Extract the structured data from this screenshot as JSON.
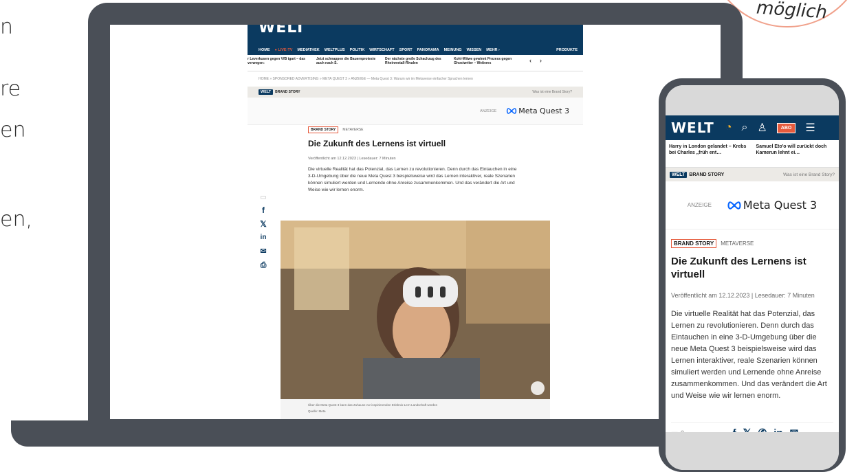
{
  "side_fragments": [
    "n",
    "re",
    "en",
    "en,"
  ],
  "badge": {
    "text": "möglich"
  },
  "desktop": {
    "logo": "WELT",
    "nav": [
      "HOME",
      "LIVE-TV",
      "MEDIATHEK",
      "WELTPLUS",
      "POLITIK",
      "WIRTSCHAFT",
      "SPORT",
      "PANORAMA",
      "MEINUNG",
      "WISSEN",
      "MEHR",
      "PRODUKTE"
    ],
    "ticker": [
      "r Leverkusen gegen VfB tgart – das verwegen:",
      "Jetzt schnappen die Bauernproteste auch nach S.",
      "Der nächste große Schachzug des Rheinmetall-Rivalen",
      "Kohl-Witwe gewinnt Prozess gegen Ghostwriter – Weiteres"
    ],
    "breadcrumb": "HOME » SPONSORED ADVERTISING » META QUEST 3 » ANZEIGE — Meta Quest 3: Warum wir im Metaverse einfacher Sprachen lernen",
    "brand_chip": "WELT",
    "brand_story": "BRAND STORY",
    "what_is": "Was ist eine Brand Story?",
    "anzeige": "ANZEIGE",
    "sponsor": "Meta Quest 3",
    "tag_boxed": "BRAND STORY",
    "tag_plain": "METAVERSE",
    "title": "Die Zukunft des Lernens ist virtuell",
    "meta": "Veröffentlicht am 12.12.2023 | Lesedauer: 7 Minuten",
    "lead": "Die virtuelle Realität hat das Potenzial, das Lernen zu revolutionieren. Denn durch das Eintauchen in eine 3-D-Umgebung über die neue Meta Quest 3 beispielsweise wird das Lernen interaktiver, reale Szenarien können simuliert werden und Lernende ohne Anreise zusammenkommen. Und das verändert die Art und Weise wie wir lernen enorm.",
    "caption": "Über die Meta Quest 3 kann das Zuhause zur inspirierenden Erlebnis-Lern-Landschaft werden",
    "caption_source": "Quelle: Meta"
  },
  "phone": {
    "logo": "WELT",
    "abo": "ABO",
    "ticker": [
      "Harry in London gelandet – Krebs bei Charles „früh ent…",
      "Samuel Eto'o will zurückt doch Kamerun lehnt ei…"
    ],
    "brand_chip": "WELT",
    "brand_story": "BRAND STORY",
    "what_is": "Was ist eine Brand Story?",
    "anzeige": "ANZEIGE",
    "sponsor": "Meta Quest 3",
    "tag_boxed": "BRAND STORY",
    "tag_plain": "METAVERSE",
    "title": "Die Zukunft des Lernens ist virtuell",
    "meta": "Veröffentlicht am 12.12.2023 | Lesedauer: 7 Minuten",
    "lead": "Die virtuelle Realität hat das Potenzial, das Lernen zu revolutionieren. Denn durch das Eintauchen in eine 3-D-Umgebung über die neue Meta Quest 3 beispielsweise wird das Lernen interaktiver, reale Szenarien können simuliert werden und Lernende ohne Anreise zusammenkommen. Und das verändert die Art und Weise wie wir lernen enorm.",
    "comment_count": "0"
  },
  "colors": {
    "welt_blue": "#0b3a60",
    "accent": "#e65a3c",
    "device": "#4a4f57"
  }
}
